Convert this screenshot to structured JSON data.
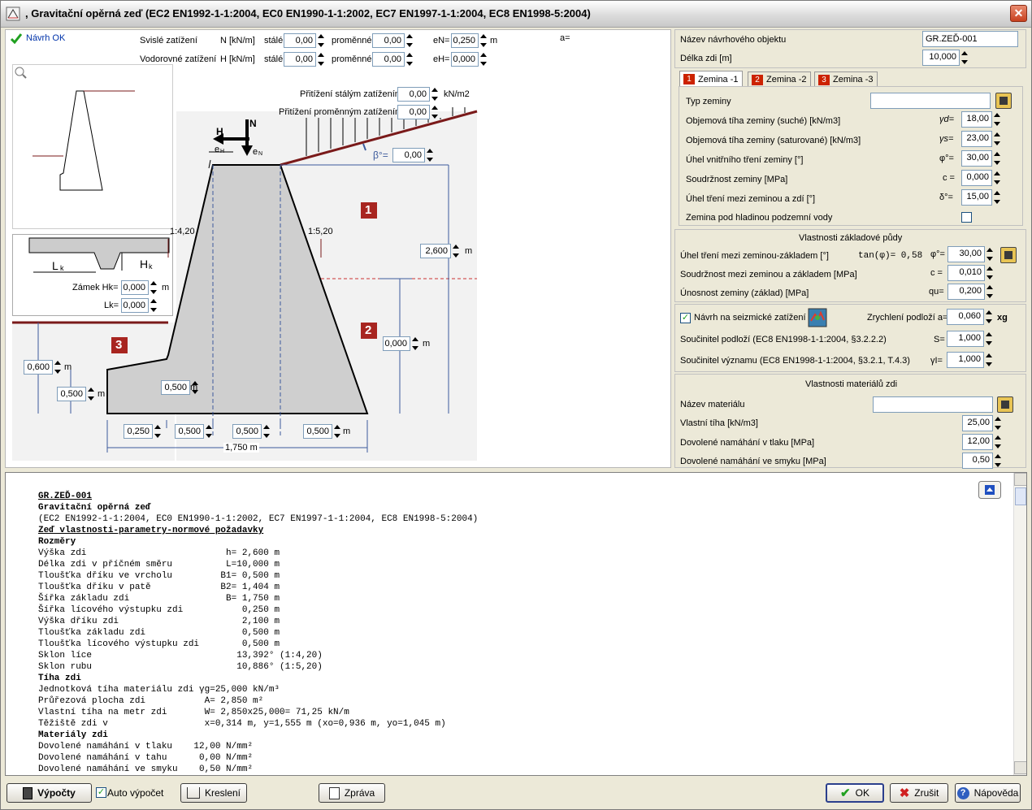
{
  "window": {
    "title": ", Gravitační opěrná zeď (EC2 EN1992-1-1:2004, EC0 EN1990-1-1:2002, EC7 EN1997-1-1:2004, EC8 EN1998-5:2004)",
    "close": "✕"
  },
  "status": {
    "text": "Návrh OK",
    "a_label": "a="
  },
  "loads": {
    "vertical_label": "Svislé zatížení",
    "vertical_unit": "N [kN/m]",
    "horizontal_label": "Vodorovné zatížení",
    "horizontal_unit": "H [kN/m]",
    "permanent": "stálé",
    "variable": "proměnné",
    "v_perm": "0,00",
    "v_var": "0,00",
    "eN_label": "eN=",
    "eN": "0,250",
    "eN_unit": "m",
    "h_perm": "0,00",
    "h_var": "0,00",
    "eH_label": "eH=",
    "eH": "0,000"
  },
  "surcharge": {
    "perm_label": "Přitížení stálým zatížením",
    "perm": "0,00",
    "unit": "kN/m2",
    "var_label": "Přitížení proměnným zatížením",
    "var": "0,00"
  },
  "diagram": {
    "H": "H",
    "N": "N",
    "eH": "e",
    "eN": "e",
    "sub": "H",
    "subN": "N",
    "beta_label": "β°=",
    "beta": "0,00",
    "slope_face": "1:4,20",
    "slope_back": "1:5,20",
    "height": "2,600",
    "height_unit": "m",
    "h2": "0,000",
    "h2_unit": "m",
    "left_h": "0,600",
    "left_h_unit": "m",
    "toe_t": "0,500",
    "toe_t_unit": "m",
    "base_t": "0,500",
    "base_t_unit": "m",
    "dims": [
      "0,250",
      "0,500",
      "0,500",
      "0,500"
    ],
    "dim_unit": "m",
    "total": "1,750 m",
    "zone1": "1",
    "zone2": "2",
    "zone3": "3"
  },
  "key": {
    "lk": "L",
    "lk_sub": "k",
    "hk": "H",
    "hk_sub": "k",
    "zamek_label": "Zámek Hk=",
    "zamek": "0,000",
    "zamek_unit": "m",
    "lk_label": "Lk=",
    "lk_val": "0,000"
  },
  "project": {
    "name_label": "Název návrhového objektu",
    "name": "GR.ZEĎ-001",
    "len_label": "Délka zdi [m]",
    "len": "10,000"
  },
  "tabs": [
    {
      "num": "1",
      "label": "Zemina -1"
    },
    {
      "num": "2",
      "label": "Zemina -2"
    },
    {
      "num": "3",
      "label": "Zemina -3"
    }
  ],
  "soil": [
    {
      "label": "Typ zeminy",
      "sym": "",
      "val": ""
    },
    {
      "label": "Objemová tíha zeminy (suché) [kN/m3]",
      "sym": "γd=",
      "val": "18,00"
    },
    {
      "label": "Objemová tíha zeminy (saturované) [kN/m3]",
      "sym": "γs=",
      "val": "23,00"
    },
    {
      "label": "Úhel vnitřního tření zeminy [°]",
      "sym": "φ°=",
      "val": "30,00"
    },
    {
      "label": "Soudržnost zeminy [MPa]",
      "sym": "c =",
      "val": "0,000"
    },
    {
      "label": "Úhel tření mezi zeminou a zdí [°]",
      "sym": "δ°=",
      "val": "15,00"
    }
  ],
  "soil_water": "Zemina pod hladinou podzemní vody",
  "base": {
    "title": "Vlastnosti základové půdy",
    "rows": [
      {
        "label": "Úhel tření mezi zeminou-základem [°]",
        "extra": "tan(φ)= 0,58",
        "sym": "φ°=",
        "val": "30,00"
      },
      {
        "label": "Soudržnost mezi zeminou a základem [MPa]",
        "extra": "",
        "sym": "c =",
        "val": "0,010"
      },
      {
        "label": "Únosnost zeminy (základ) [MPa]",
        "extra": "",
        "sym": "qu=",
        "val": "0,200"
      }
    ]
  },
  "seismic": {
    "check": "✓",
    "label": "Návrh na seizmické zatížení",
    "acc_label": "Zrychlení podloží a=",
    "acc": "0,060",
    "acc_unit": "xg",
    "s_label": "Součinitel podloží (EC8 EN1998-1-1:2004, §3.2.2.2)",
    "s_sym": "S=",
    "s": "1,000",
    "g_label": "Součinitel významu (EC8 EN1998-1-1:2004, §3.2.1, T.4.3)",
    "g_sym": "γI=",
    "g": "1,000"
  },
  "material": {
    "title": "Vlastnosti materiálů zdi",
    "name_label": "Název materiálu",
    "name": "",
    "rows": [
      {
        "label": "Vlastní tíha [kN/m3]",
        "val": "25,00"
      },
      {
        "label": "Dovolené namáhání v tlaku  [MPa]",
        "val": "12,00"
      },
      {
        "label": "Dovolené namáhání ve smyku  [MPa]",
        "val": "0,50"
      }
    ]
  },
  "report": [
    {
      "t": "GR.ZEĎ-001",
      "s": "bu"
    },
    {
      "t": "Gravitační opěrná zeď",
      "s": "b"
    },
    {
      "t": "(EC2 EN1992-1-1:2004, EC0 EN1990-1-1:2002, EC7 EN1997-1-1:2004, EC8 EN1998-5:2004)",
      "s": ""
    },
    {
      "t": "Zeď vlastnosti-parametry-normové požadavky",
      "s": "bu"
    },
    {
      "t": "Rozměry",
      "s": "b"
    },
    {
      "t": "Výška zdi                          h= 2,600 m",
      "s": ""
    },
    {
      "t": "Délka zdi v příčném směru          L=10,000 m",
      "s": ""
    },
    {
      "t": "Tloušťka dříku ve vrcholu         B1= 0,500 m",
      "s": ""
    },
    {
      "t": "Tloušťka dříku v patě             B2= 1,404 m",
      "s": ""
    },
    {
      "t": "Šířka základu zdi                  B= 1,750 m",
      "s": ""
    },
    {
      "t": "Šířka lícového výstupku zdi           0,250 m",
      "s": ""
    },
    {
      "t": "Výška dříku zdi                       2,100 m",
      "s": ""
    },
    {
      "t": "Tloušťka základu zdi                  0,500 m",
      "s": ""
    },
    {
      "t": "Tloušťka lícového výstupku zdi        0,500 m",
      "s": ""
    },
    {
      "t": "Sklon líce                           13,392° (1:4,20)",
      "s": ""
    },
    {
      "t": "Sklon rubu                           10,886° (1:5,20)",
      "s": ""
    },
    {
      "t": "Tíha zdi",
      "s": "b"
    },
    {
      "t": "Jednotková tíha materiálu zdi γg=25,000 kN/m³",
      "s": ""
    },
    {
      "t": "Průřezová plocha zdi           A= 2,850 m²",
      "s": ""
    },
    {
      "t": "Vlastní tíha na metr zdi       W= 2,850x25,000= 71,25 kN/m",
      "s": ""
    },
    {
      "t": "Těžiště zdi v                  x=0,314 m, y=1,555 m (xo=0,936 m, yo=1,045 m)",
      "s": ""
    },
    {
      "t": "Materiály zdi",
      "s": "b"
    },
    {
      "t": "Dovolené namáhání v tlaku    12,00 N/mm²",
      "s": ""
    },
    {
      "t": "Dovolené namáhání v tahu      0,00 N/mm²",
      "s": ""
    },
    {
      "t": "Dovolené namáhání ve smyku    0,50 N/mm²",
      "s": ""
    }
  ],
  "buttons": {
    "calc": "Výpočty",
    "auto": "Auto výpočet",
    "auto_check": "✓",
    "draw": "Kreslení",
    "report": "Zpráva",
    "ok": "OK",
    "cancel": "Zrušit",
    "help": "Nápověda"
  }
}
